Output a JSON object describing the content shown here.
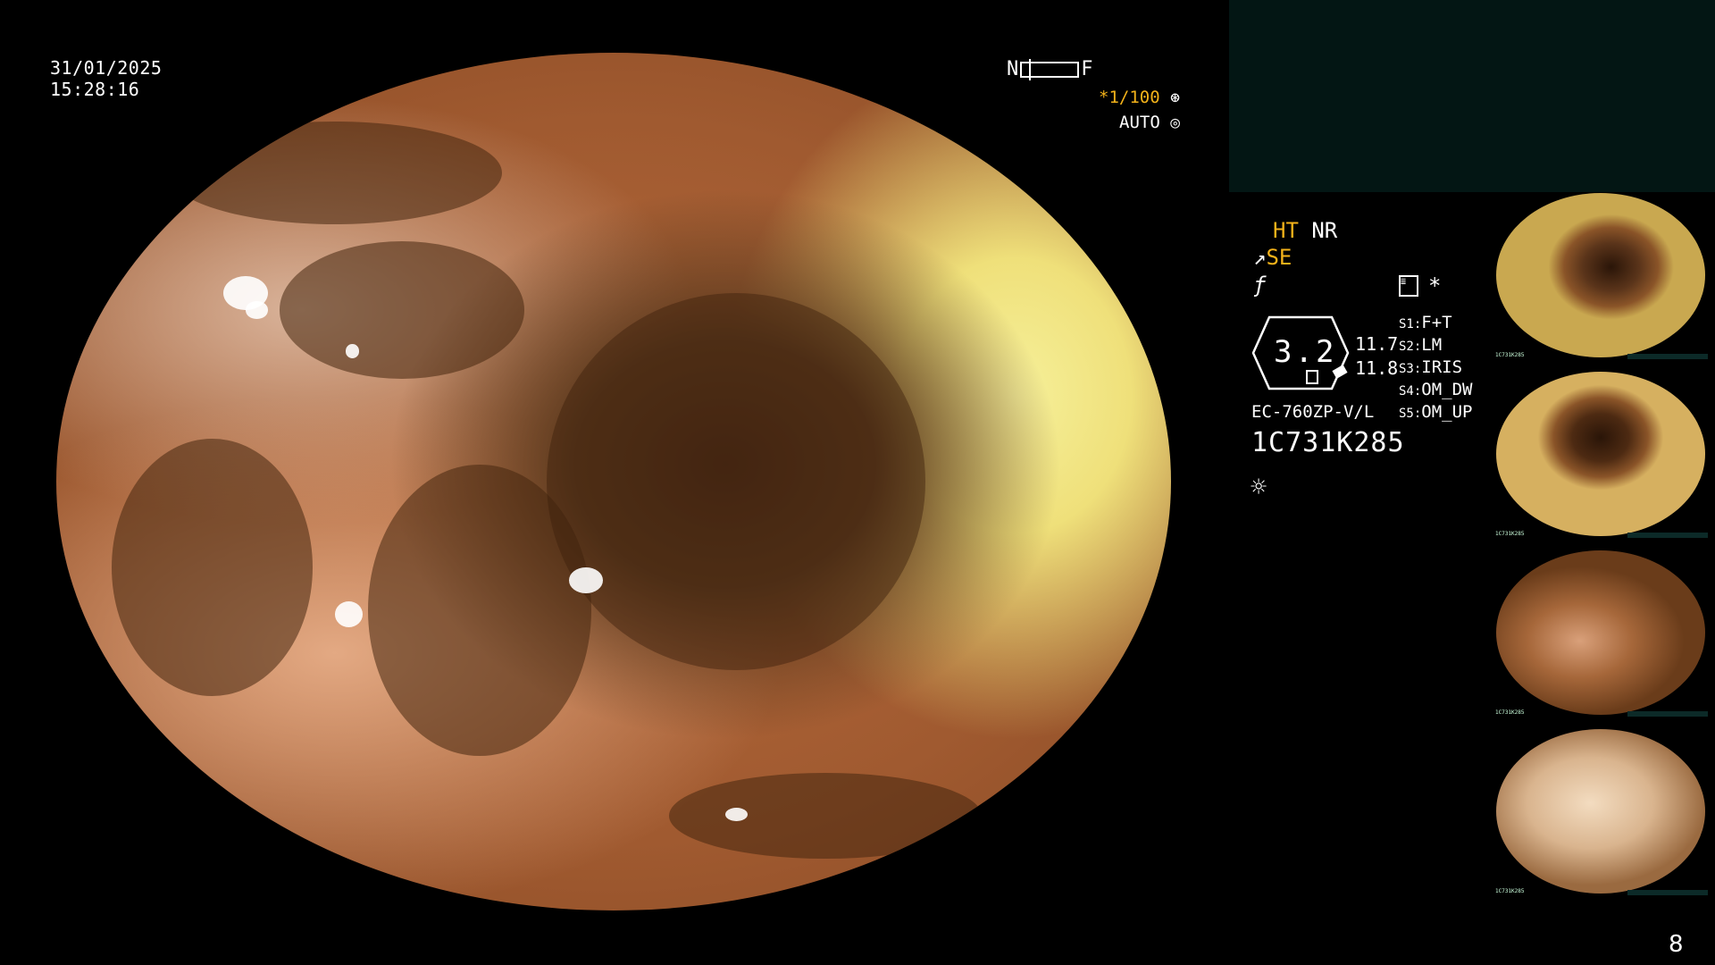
{
  "datetime": {
    "date": "31/01/2025",
    "time": "15:28:16"
  },
  "nf_indicator": {
    "left": "N",
    "right": "F"
  },
  "shutter": {
    "value": "*1/100",
    "icon": "shutter-icon"
  },
  "exposure": {
    "value": "AUTO",
    "icon": "iris-icon"
  },
  "modes": {
    "ht": "HT",
    "nr": "NR",
    "se": "SE",
    "f_icon": "f-symbol-icon"
  },
  "gauge": {
    "value": "3.2",
    "reading1": "11.7",
    "reading2": "11.8"
  },
  "settings": [
    {
      "key": "S1:",
      "value": "F+T"
    },
    {
      "key": "S2:",
      "value": "LM"
    },
    {
      "key": "S3:",
      "value": "IRIS"
    },
    {
      "key": "S4:",
      "value": "OM_DW"
    },
    {
      "key": "S5:",
      "value": "OM_UP"
    }
  ],
  "scope": {
    "model": "EC-760ZP-V/L",
    "serial": "1C731K285"
  },
  "icons": {
    "light": "sun-icon",
    "memo": "list-icon",
    "star": "asterisk-icon"
  },
  "thumbnails": [
    {
      "caption": "1C731K285",
      "tone": "#7a4a22"
    },
    {
      "caption": "1C731K285",
      "tone": "#6a3c1a"
    },
    {
      "caption": "1C731K285",
      "tone": "#a66a3a"
    },
    {
      "caption": "1C731K285",
      "tone": "#e8c7a4"
    }
  ],
  "page_number": "8"
}
